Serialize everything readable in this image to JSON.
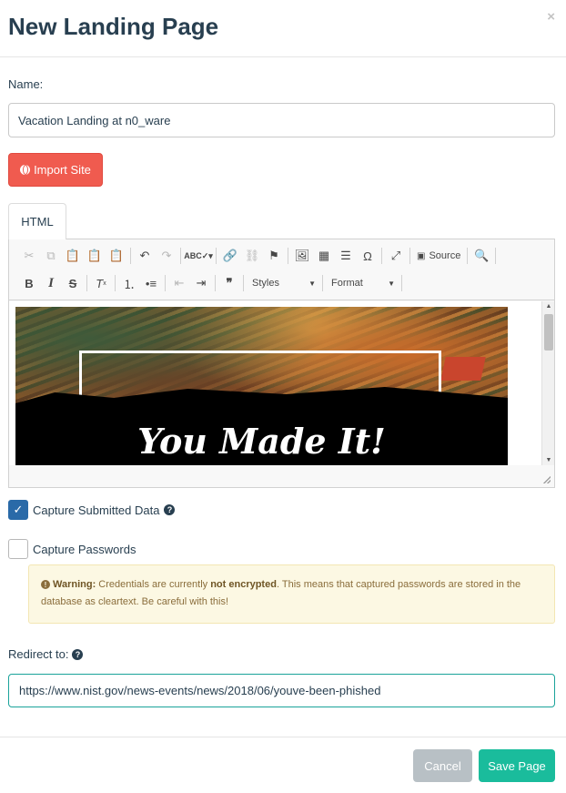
{
  "modal": {
    "title": "New Landing Page",
    "close_glyph": "×"
  },
  "name": {
    "label": "Name:",
    "value": "Vacation Landing at n0_ware"
  },
  "import_button": {
    "label": "Import Site",
    "icon": "globe-icon",
    "color": "#f05b4f"
  },
  "tabs": [
    {
      "label": "HTML"
    }
  ],
  "editor": {
    "toolbar": {
      "source_label": "Source",
      "styles_label": "Styles",
      "format_label": "Format"
    },
    "preview_heading": "You Made It!"
  },
  "capture_data": {
    "label": "Capture Submitted Data",
    "checked": true
  },
  "capture_passwords": {
    "label": "Capture Passwords",
    "checked": false
  },
  "warning": {
    "title": "Warning:",
    "text_before": " Credentials are currently ",
    "emphasis": "not encrypted",
    "text_after": ". This means that captured passwords are stored in the database as cleartext. Be careful with this!"
  },
  "redirect": {
    "label": "Redirect to:",
    "value": "https://www.nist.gov/news-events/news/2018/06/youve-been-phished"
  },
  "footer": {
    "cancel_label": "Cancel",
    "save_label": "Save Page"
  },
  "colors": {
    "primary": "#1abc9c",
    "danger": "#f05b4f",
    "checkbox": "#2a6aa8",
    "warning_bg": "#fcf8e3"
  }
}
